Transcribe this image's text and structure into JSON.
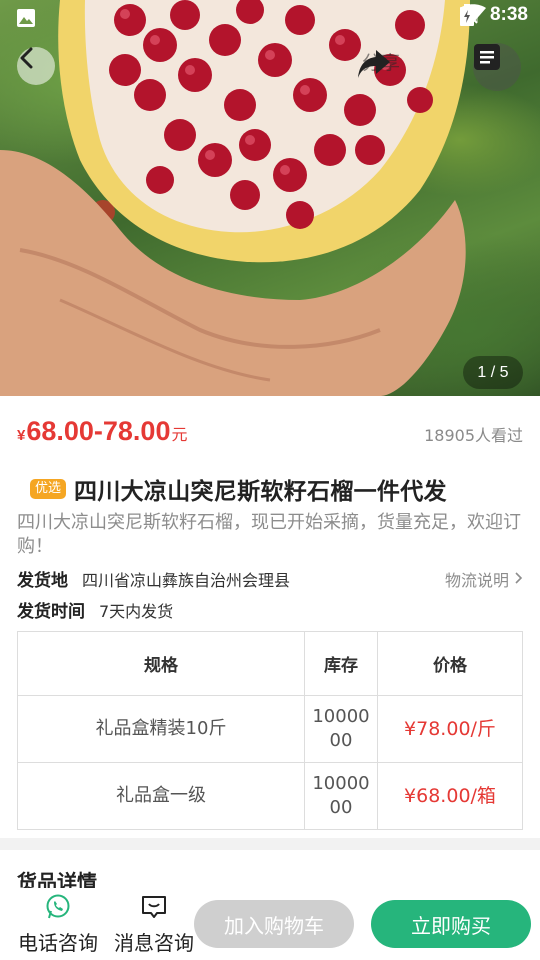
{
  "status_bar": {
    "time": "8:38",
    "icons": [
      "image-icon",
      "wifi-icon",
      "no-signal-icon",
      "battery-charging-icon"
    ]
  },
  "header": {
    "back_icon": "chevron-left-icon",
    "share_label": "分享",
    "share_icon": "share-arrow-icon",
    "doc_icon": "document-icon"
  },
  "gallery": {
    "page_indicator": "1 / 5",
    "current": 1,
    "total": 5
  },
  "product": {
    "price_currency": "¥",
    "price_range": "68.00-78.00",
    "price_unit": "元",
    "viewers": "18905人看过",
    "badge": "优选",
    "title": "四川大凉山突尼斯软籽石榴一件代发",
    "description": "四川大凉山突尼斯软籽石榴，现已开始采摘，货量充足，欢迎订购！",
    "ship_from_label": "发货地",
    "ship_from_value": "四川省凉山彝族自治州会理县",
    "logistics_label": "物流说明",
    "ship_time_label": "发货时间",
    "ship_time_value": "7天内发货"
  },
  "spec_table": {
    "headers": [
      "规格",
      "库存",
      "价格"
    ],
    "rows": [
      {
        "spec": "礼品盒精装10斤",
        "stock": "1000000",
        "price": "¥78.00/斤"
      },
      {
        "spec": "礼品盒一级",
        "stock": "1000000",
        "price": "¥68.00/箱"
      }
    ]
  },
  "details_heading": "货品详情",
  "bottom_bar": {
    "phone_label": "电话咨询",
    "message_label": "消息咨询",
    "cart_label": "加入购物车",
    "buy_label": "立即购买"
  },
  "colors": {
    "price_red": "#e53935",
    "buy_green": "#26b57c",
    "cart_grey": "#cfcfcf",
    "badge_orange": "#f5a623",
    "chat_green": "#26b57c"
  }
}
